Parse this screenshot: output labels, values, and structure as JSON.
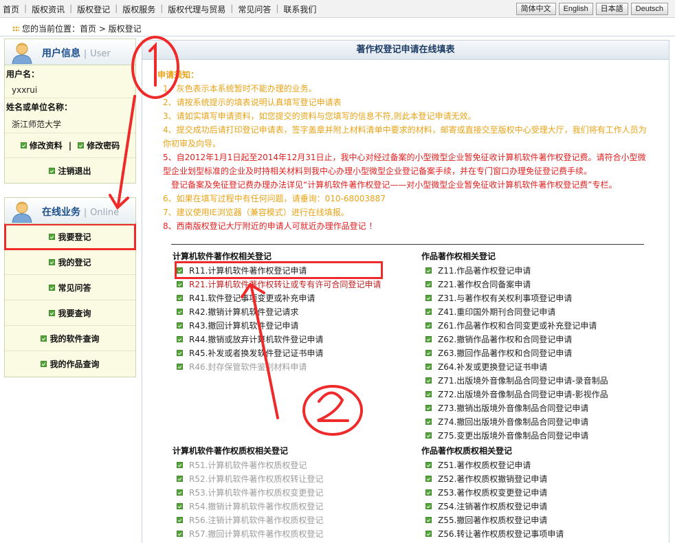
{
  "topnav": [
    "首页",
    "版权资讯",
    "版权登记",
    "版权服务",
    "版权代理与贸易",
    "常见问答",
    "联系我们"
  ],
  "languages": [
    "简体中文",
    "English",
    "日本語",
    "Deutsch"
  ],
  "breadcrumb": "您的当前位置：首页 > 版权登记",
  "user_box": {
    "title": "用户信息",
    "subtitle": "User",
    "username_label": "用户名：",
    "username": "yxxrui",
    "org_label": "姓名或单位名称：",
    "org": "浙江师范大学",
    "edit_profile": "修改资料",
    "edit_password": "修改密码",
    "link_sep": "|",
    "logout": "注销退出"
  },
  "online_box": {
    "title": "在线业务",
    "subtitle": "Online",
    "items": [
      "我要登记",
      "我的登记",
      "常见问答",
      "我要查询",
      "我的软件查询",
      "我的作品查询"
    ]
  },
  "main": {
    "title": "著作权登记申请在线填表",
    "notice_title": "申请须知：",
    "notices": [
      "1、灰色表示本系统暂时不能办理的业务。",
      "2、请按系统提示的填表说明认真填写登记申请表",
      "3、请如实填写申请资料，如您提交的资料与您填写的信息不符,则此本登记申请无效。",
      "4、提交成功后请打印登记申请表，签字盖章并附上材料清单中要求的材料，邮寄或直接交至版权中心受理大厅，我们将有工作人员为你初审及向导。",
      "5、自2012年1月1日起至2014年12月31日止，我中心对经过备案的小型微型企业暂免征收计算机软件著作权登记费。请符合小型微型企业划型标准的企业及时持相关材料到我中心办理小型微型企业登记备案手续，并在专门窗口办理免征登记费手续。",
      "登记备案及免征登记费办理办法详见“计算机软件著作权登记——对小型微型企业暂免征收计算机软件著作权登记费”专栏。",
      "6、如果在填写过程中有任何问题，请垂询：010-68003887",
      "7、建议使用IE浏览器（兼容模式）进行在线填报。",
      "8、西南版权登记大厅附近的申请人可就近办理作品登记 ！"
    ],
    "software_title": "计算机软件著作权相关登记",
    "software_items": [
      "R11.计算机软件著作权登记申请",
      "R21.计算机软件著作权转让或专有许可合同登记申请",
      "R41.软件登记事项变更或补充申请",
      "R42.撤销计算机软件登记请求",
      "R43.撤回计算机软件登记申请",
      "R44.撤销或放弃计算机软件登记申请",
      "R45.补发或者换发软件登记证书申请",
      "R46.封存保管软件鉴别材料申请"
    ],
    "works_title": "作品著作权相关登记",
    "works_items": [
      "Z11.作品著作权登记申请",
      "Z21.著作权合同备案申请",
      "Z31.与著作权有关权利事项登记申请",
      "Z41.重印国外期刊合同登记申请",
      "Z61.作品著作权和合同变更或补充登记申请",
      "Z62.撤销作品著作权和合同登记申请",
      "Z63.撤回作品著作权和合同登记申请",
      "Z64.补发或更换登记证书申请",
      "Z71.出版境外音像制品合同登记申请-录音制品",
      "Z72.出版境外音像制品合同登记申请-影视作品",
      "Z73.撤销出版境外音像制品合同登记申请",
      "Z74.撤回出版境外音像制品合同登记申请",
      "Z75.变更出版境外音像制品合同登记申请"
    ],
    "sw_pledge_title": "计算机软件著作权质权相关登记",
    "sw_pledge_items": [
      "R51.计算机软件著作权质权登记",
      "R52.计算机软件著作权质权转让登记",
      "R53.计算机软件著作权质权变更登记",
      "R54.撤销计算机软件著作权质权登记",
      "R56.注销计算机软件著作权质权登记",
      "R57.撤回计算机软件著作权质权登记"
    ],
    "wk_pledge_title": "作品著作权质权相关登记",
    "wk_pledge_items": [
      "Z51.著作权质权登记申请",
      "Z52.著作权质权撤销登记申请",
      "Z53.著作权质权变更登记申请",
      "Z54.注销著作权质权登记申请",
      "Z55.撤回著作权质权登记申请",
      "Z56.转让著作权质权登记事项申请"
    ]
  },
  "annotations": {
    "mark1": "1",
    "mark2": "2",
    "color": "#ef2a2a"
  }
}
